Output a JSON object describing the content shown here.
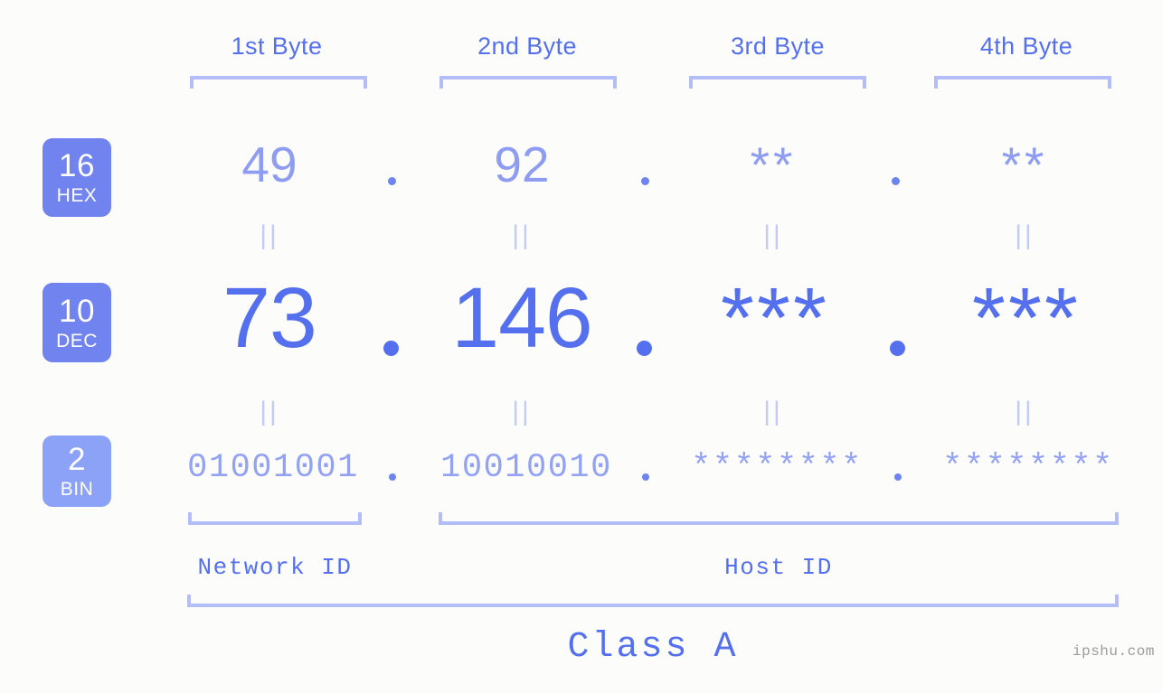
{
  "meta": {
    "background_color": "#fcfdfa",
    "accent_strong": "#5570ee",
    "accent_mid": "#8e9cf2",
    "accent_light": "#b3bdf7",
    "badge_fill_dark": "#7083ee",
    "badge_fill_light": "#8ba2f7",
    "watermark": "ipshu.com"
  },
  "headers": {
    "byte1": "1st Byte",
    "byte2": "2nd Byte",
    "byte3": "3rd Byte",
    "byte4": "4th Byte"
  },
  "bases": {
    "hex": {
      "number": "16",
      "name": "HEX"
    },
    "dec": {
      "number": "10",
      "name": "DEC"
    },
    "bin": {
      "number": "2",
      "name": "BIN"
    }
  },
  "equals_mark": "||",
  "separator": ".",
  "rows": {
    "hex": {
      "values": [
        "49",
        "92",
        "**",
        "**"
      ],
      "known": [
        true,
        true,
        false,
        false
      ]
    },
    "dec": {
      "values": [
        "73",
        "146",
        "***",
        "***"
      ],
      "known": [
        true,
        true,
        false,
        false
      ]
    },
    "bin": {
      "values": [
        "01001001",
        "10010010",
        "********",
        "********"
      ],
      "known": [
        true,
        true,
        false,
        false
      ]
    }
  },
  "footer": {
    "network_id": "Network ID",
    "host_id": "Host ID",
    "class_label": "Class A"
  }
}
